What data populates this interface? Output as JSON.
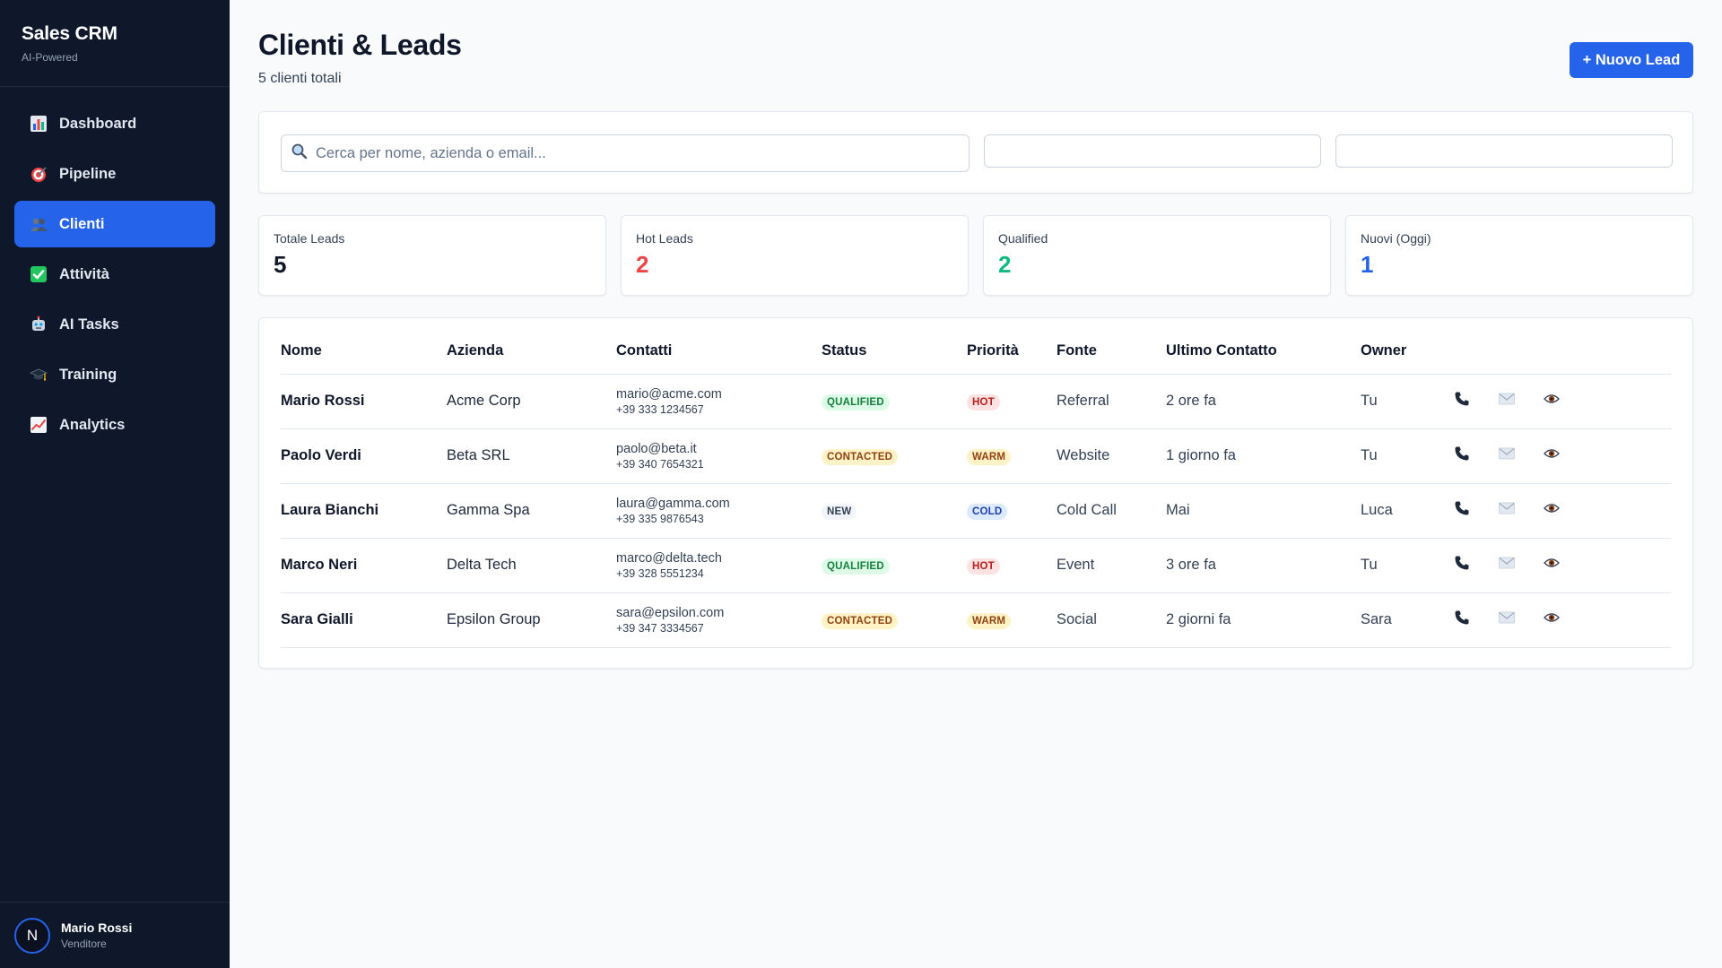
{
  "brand": {
    "title": "Sales CRM",
    "subtitle": "AI-Powered"
  },
  "nav": [
    {
      "label": "Dashboard",
      "icon": "bar-chart-icon",
      "active": false
    },
    {
      "label": "Pipeline",
      "icon": "target-icon",
      "active": false
    },
    {
      "label": "Clienti",
      "icon": "people-icon",
      "active": true
    },
    {
      "label": "Attività",
      "icon": "checkmark-icon",
      "active": false
    },
    {
      "label": "AI Tasks",
      "icon": "robot-icon",
      "active": false
    },
    {
      "label": "Training",
      "icon": "graduation-cap-icon",
      "active": false
    },
    {
      "label": "Analytics",
      "icon": "trending-chart-icon",
      "active": false
    }
  ],
  "user": {
    "initial": "N",
    "name": "Mario Rossi",
    "role": "Venditore"
  },
  "header": {
    "title": "Clienti & Leads",
    "subtitle": "5 clienti totali",
    "new_button": "+ Nuovo Lead"
  },
  "filters": {
    "search_placeholder": "Cerca per nome, azienda o email...",
    "search_value": "",
    "status_value": "",
    "priority_value": ""
  },
  "stats": [
    {
      "label": "Totale Leads",
      "value": "5",
      "color": "#0f172a"
    },
    {
      "label": "Hot Leads",
      "value": "2",
      "color": "#ef4444"
    },
    {
      "label": "Qualified",
      "value": "2",
      "color": "#10b981"
    },
    {
      "label": "Nuovi (Oggi)",
      "value": "1",
      "color": "#2563eb"
    }
  ],
  "table": {
    "columns": [
      "Nome",
      "Azienda",
      "Contatti",
      "Status",
      "Priorità",
      "Fonte",
      "Ultimo Contatto",
      "Owner"
    ],
    "rows": [
      {
        "name": "Mario Rossi",
        "company": "Acme Corp",
        "email": "mario@acme.com",
        "phone": "+39 333 1234567",
        "status": "QUALIFIED",
        "priority": "HOT",
        "source": "Referral",
        "last_contact": "2 ore fa",
        "owner": "Tu"
      },
      {
        "name": "Paolo Verdi",
        "company": "Beta SRL",
        "email": "paolo@beta.it",
        "phone": "+39 340 7654321",
        "status": "CONTACTED",
        "priority": "WARM",
        "source": "Website",
        "last_contact": "1 giorno fa",
        "owner": "Tu"
      },
      {
        "name": "Laura Bianchi",
        "company": "Gamma Spa",
        "email": "laura@gamma.com",
        "phone": "+39 335 9876543",
        "status": "NEW",
        "priority": "COLD",
        "source": "Cold Call",
        "last_contact": "Mai",
        "owner": "Luca"
      },
      {
        "name": "Marco Neri",
        "company": "Delta Tech",
        "email": "marco@delta.tech",
        "phone": "+39 328 5551234",
        "status": "QUALIFIED",
        "priority": "HOT",
        "source": "Event",
        "last_contact": "3 ore fa",
        "owner": "Tu"
      },
      {
        "name": "Sara Gialli",
        "company": "Epsilon Group",
        "email": "sara@epsilon.com",
        "phone": "+39 347 3334567",
        "status": "CONTACTED",
        "priority": "WARM",
        "source": "Social",
        "last_contact": "2 giorni fa",
        "owner": "Sara"
      }
    ],
    "row_actions": [
      "phone-icon",
      "envelope-icon",
      "eye-icon"
    ]
  },
  "badge_colors": {
    "QUALIFIED": {
      "bg": "#dcfce7",
      "fg": "#15803d"
    },
    "CONTACTED": {
      "bg": "#fef3c7",
      "fg": "#92400e"
    },
    "NEW": {
      "bg": "#f1f5f9",
      "fg": "#334155"
    },
    "HOT": {
      "bg": "#fee2e2",
      "fg": "#b91c1c"
    },
    "WARM": {
      "bg": "#fef3c7",
      "fg": "#92400e"
    },
    "COLD": {
      "bg": "#dbeafe",
      "fg": "#1e40af"
    }
  },
  "colors": {
    "sidebar_bg": "#0f172a",
    "accent": "#2563eb",
    "page_bg": "#f8fafc"
  }
}
